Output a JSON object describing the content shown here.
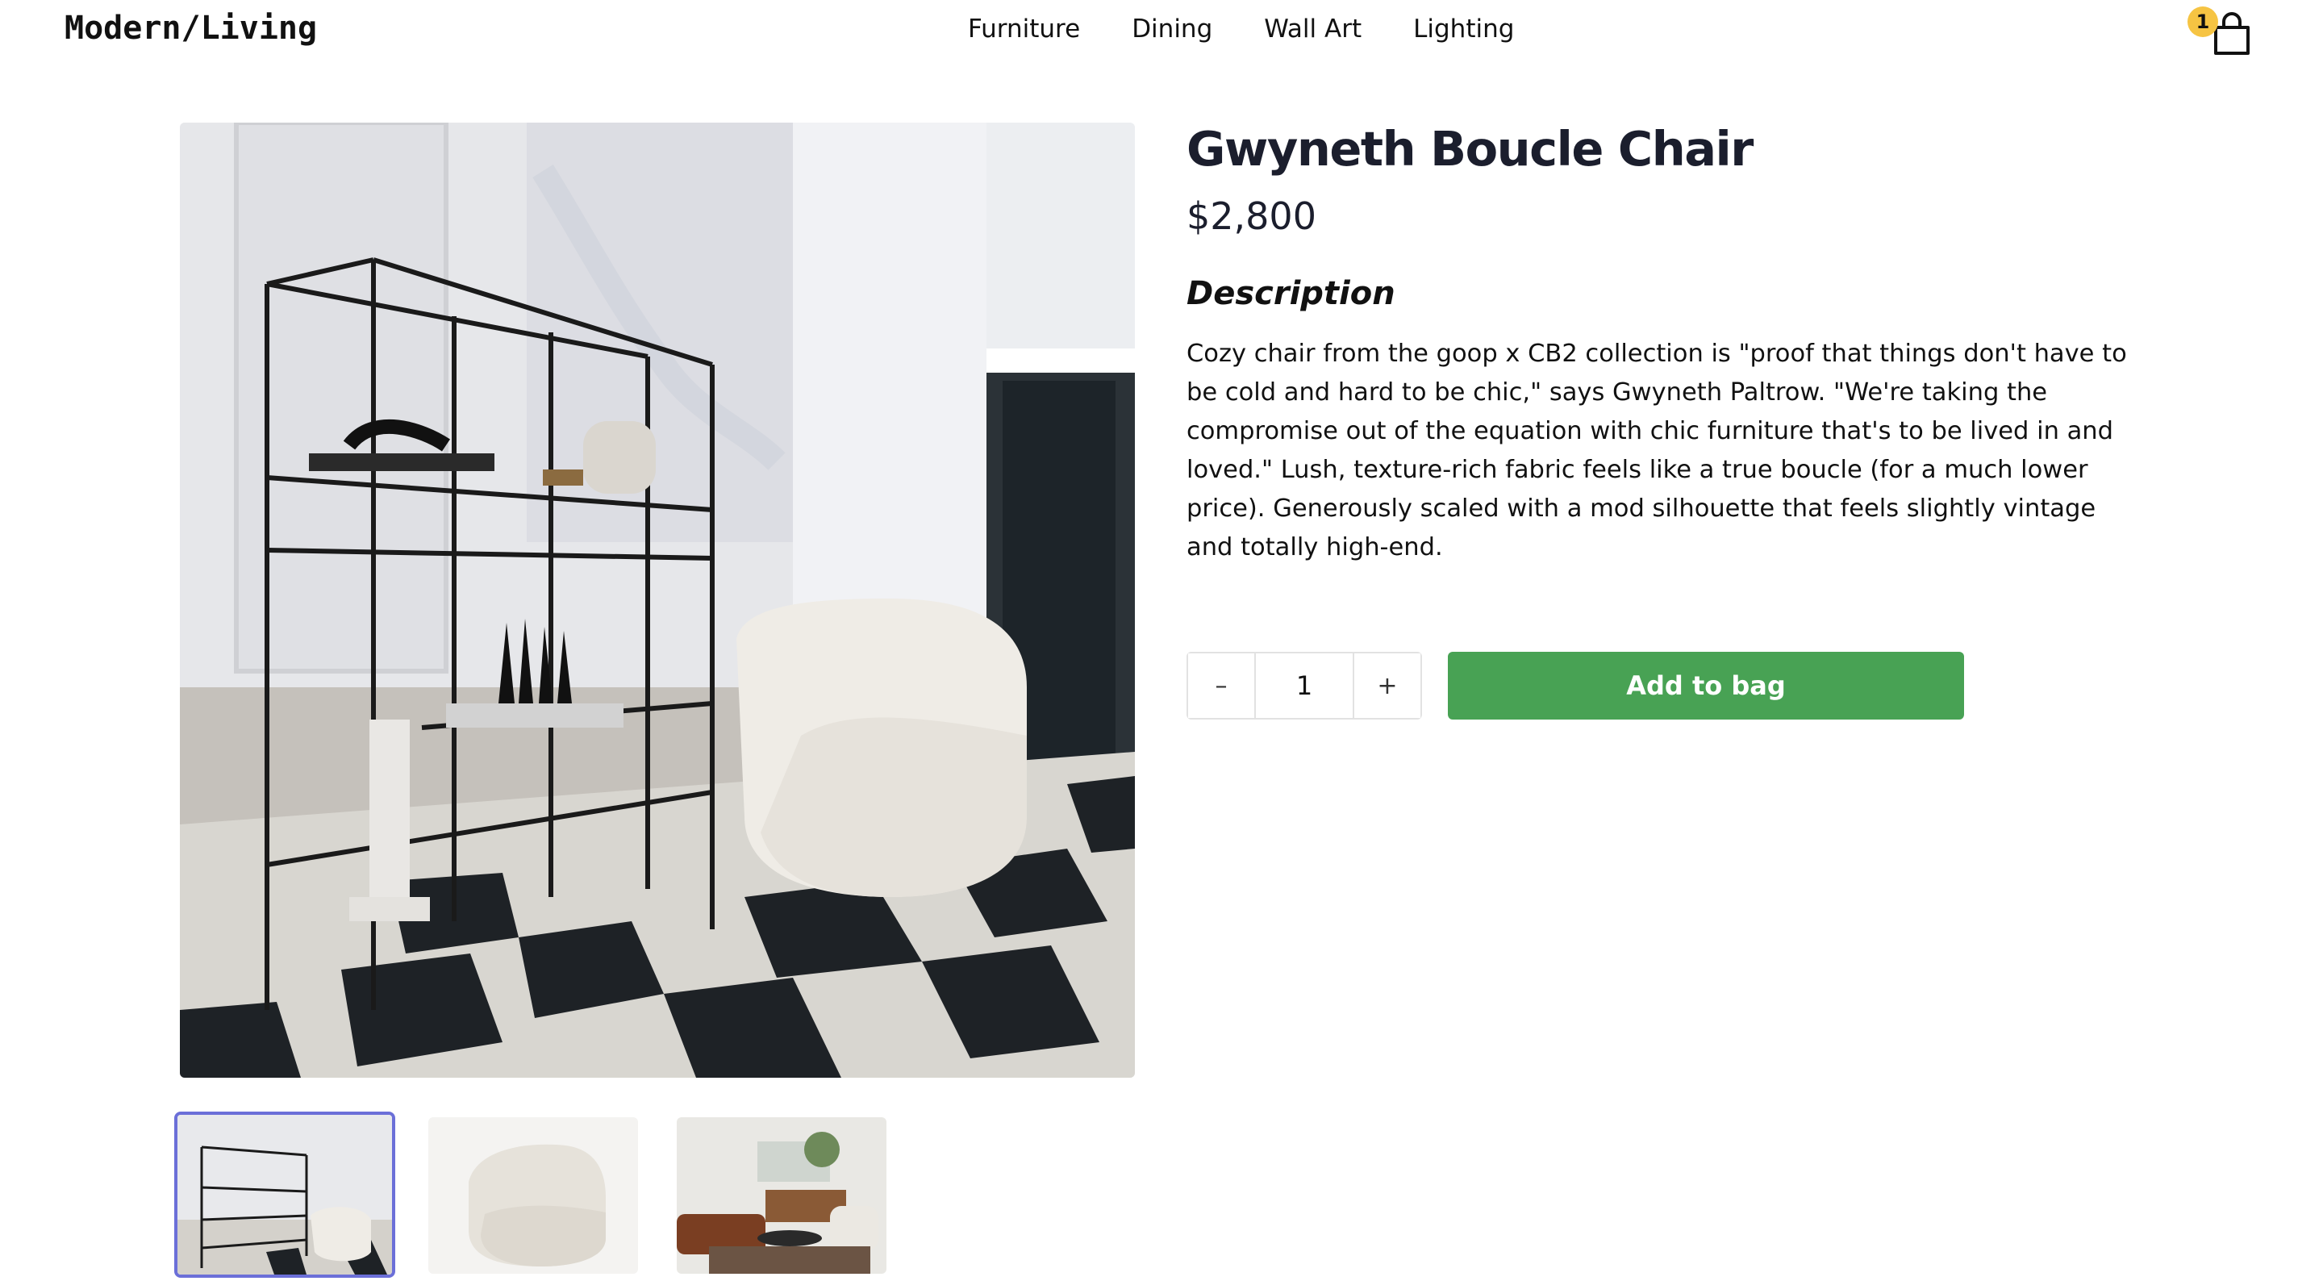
{
  "header": {
    "logo": "Modern/Living",
    "nav": [
      "Furniture",
      "Dining",
      "Wall Art",
      "Lighting"
    ],
    "cart_count": "1",
    "cart_icon": "shopping-bag-icon"
  },
  "product": {
    "title": "Gwyneth Boucle Chair",
    "price": "$2,800",
    "description_heading": "Description",
    "description": "Cozy chair from the goop x CB2 collection is \"proof that things don't have to be cold and hard to be chic,\" says Gwyneth Paltrow. \"We're taking the compromise out of the equation with chic furniture that's to be lived in and loved.\" Lush, texture-rich fabric feels like a true boucle (for a much lower price). Generously scaled with a mod silhouette that feels slightly vintage and totally high-end.",
    "quantity": "1",
    "decrement_label": "–",
    "increment_label": "+",
    "add_to_bag_label": "Add to bag"
  },
  "gallery": {
    "selected_index": 0,
    "thumbnail_count": 3
  },
  "colors": {
    "add_button": "#48a254",
    "badge": "#f6c443",
    "thumb_selected_border": "#6b6fd8",
    "title": "#1b1e2d"
  }
}
